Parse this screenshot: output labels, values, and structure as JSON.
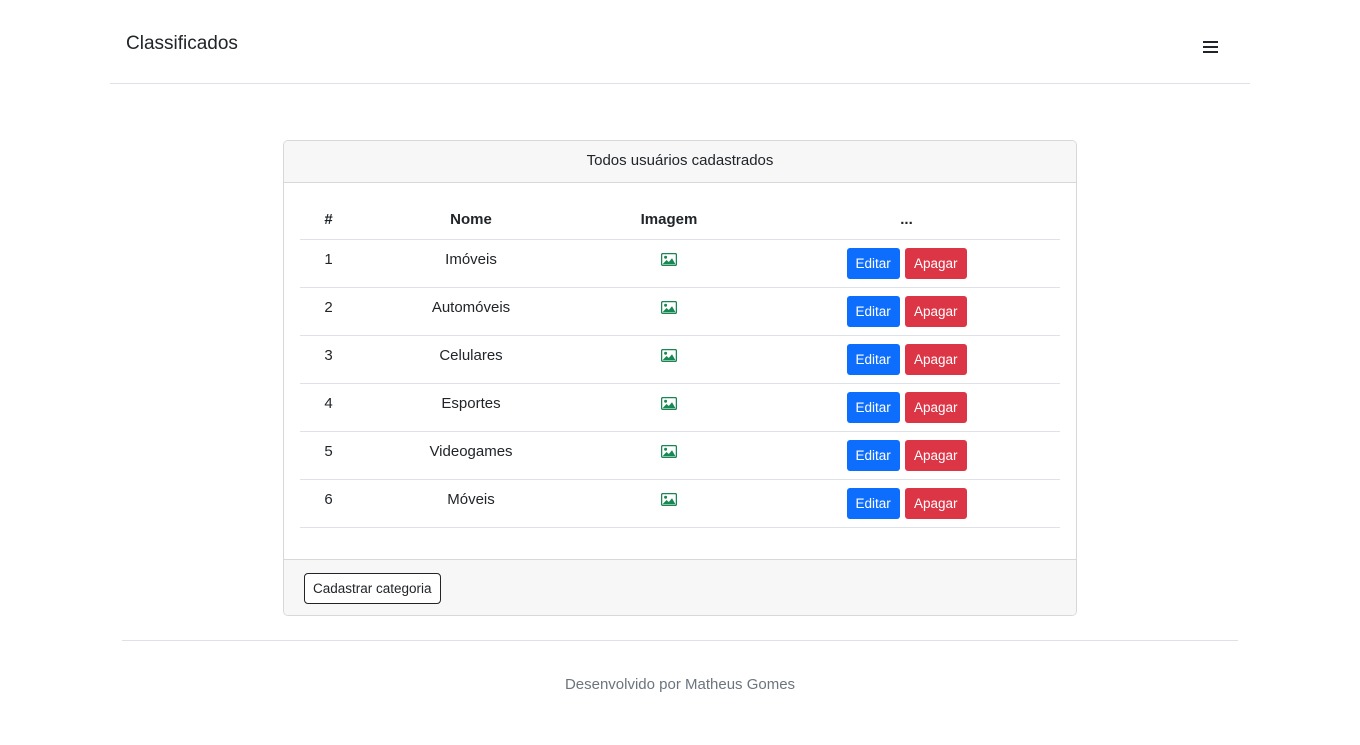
{
  "navbar": {
    "brand": "Classificados",
    "menu_icon": "hamburger-menu-icon"
  },
  "card": {
    "header": "Todos usuários cadastrados",
    "table": {
      "columns": [
        "#",
        "Nome",
        "Imagem",
        "..."
      ],
      "rows": [
        {
          "id": "1",
          "name": "Imóveis",
          "image_icon": "image-icon",
          "edit_label": "Editar",
          "delete_label": "Apagar"
        },
        {
          "id": "2",
          "name": "Automóveis",
          "image_icon": "image-icon",
          "edit_label": "Editar",
          "delete_label": "Apagar"
        },
        {
          "id": "3",
          "name": "Celulares",
          "image_icon": "image-icon",
          "edit_label": "Editar",
          "delete_label": "Apagar"
        },
        {
          "id": "4",
          "name": "Esportes",
          "image_icon": "image-icon",
          "edit_label": "Editar",
          "delete_label": "Apagar"
        },
        {
          "id": "5",
          "name": "Videogames",
          "image_icon": "image-icon",
          "edit_label": "Editar",
          "delete_label": "Apagar"
        },
        {
          "id": "6",
          "name": "Móveis",
          "image_icon": "image-icon",
          "edit_label": "Editar",
          "delete_label": "Apagar"
        }
      ]
    },
    "footer_button": "Cadastrar categoria"
  },
  "footer": {
    "text": "Desenvolvido por Matheus Gomes"
  },
  "colors": {
    "primary": "#0d6efd",
    "danger": "#dc3545",
    "image_icon": "#198754"
  }
}
